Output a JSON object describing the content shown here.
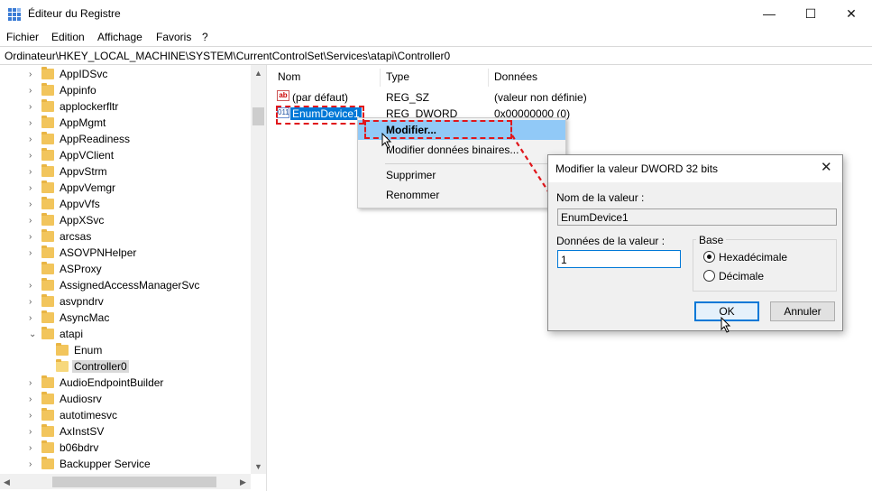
{
  "window": {
    "title": "Éditeur du Registre",
    "minimize": "—",
    "maximize": "☐",
    "close": "✕"
  },
  "menu": [
    "Fichier",
    "Edition",
    "Affichage",
    "Favoris",
    "?"
  ],
  "address": "Ordinateur\\HKEY_LOCAL_MACHINE\\SYSTEM\\CurrentControlSet\\Services\\atapi\\Controller0",
  "tree": {
    "items": [
      {
        "label": "AppIDSvc",
        "expander": "›",
        "indent": 0
      },
      {
        "label": "Appinfo",
        "expander": "›",
        "indent": 0
      },
      {
        "label": "applockerfltr",
        "expander": "›",
        "indent": 0
      },
      {
        "label": "AppMgmt",
        "expander": "›",
        "indent": 0
      },
      {
        "label": "AppReadiness",
        "expander": "›",
        "indent": 0
      },
      {
        "label": "AppVClient",
        "expander": "›",
        "indent": 0
      },
      {
        "label": "AppvStrm",
        "expander": "›",
        "indent": 0
      },
      {
        "label": "AppvVemgr",
        "expander": "›",
        "indent": 0
      },
      {
        "label": "AppvVfs",
        "expander": "›",
        "indent": 0
      },
      {
        "label": "AppXSvc",
        "expander": "›",
        "indent": 0
      },
      {
        "label": "arcsas",
        "expander": "›",
        "indent": 0
      },
      {
        "label": "ASOVPNHelper",
        "expander": "›",
        "indent": 0
      },
      {
        "label": "ASProxy",
        "expander": "",
        "indent": 0
      },
      {
        "label": "AssignedAccessManagerSvc",
        "expander": "›",
        "indent": 0
      },
      {
        "label": "asvpndrv",
        "expander": "›",
        "indent": 0
      },
      {
        "label": "AsyncMac",
        "expander": "›",
        "indent": 0
      },
      {
        "label": "atapi",
        "expander": "⌄",
        "indent": 0
      },
      {
        "label": "Enum",
        "expander": "",
        "indent": 1
      },
      {
        "label": "Controller0",
        "expander": "",
        "indent": 1,
        "selected": true
      },
      {
        "label": "AudioEndpointBuilder",
        "expander": "›",
        "indent": 0
      },
      {
        "label": "Audiosrv",
        "expander": "›",
        "indent": 0
      },
      {
        "label": "autotimesvc",
        "expander": "›",
        "indent": 0
      },
      {
        "label": "AxInstSV",
        "expander": "›",
        "indent": 0
      },
      {
        "label": "b06bdrv",
        "expander": "›",
        "indent": 0
      },
      {
        "label": "Backupper Service",
        "expander": "›",
        "indent": 0
      }
    ]
  },
  "list": {
    "columns": [
      "Nom",
      "Type",
      "Données"
    ],
    "rows": [
      {
        "icon": "ab",
        "name": "(par défaut)",
        "type": "REG_SZ",
        "data": "(valeur non définie)"
      },
      {
        "icon": "011",
        "name": "EnumDevice1",
        "type": "REG_DWORD",
        "data": "0x00000000 (0)"
      }
    ]
  },
  "context_menu": {
    "items": [
      "Modifier...",
      "Modifier données binaires...",
      "Supprimer",
      "Renommer"
    ]
  },
  "dialog": {
    "title": "Modifier la valeur DWORD 32 bits",
    "close": "✕",
    "name_label": "Nom de la valeur :",
    "name_value": "EnumDevice1",
    "data_label": "Données de la valeur :",
    "data_value": "1",
    "base_label": "Base",
    "base_options": [
      "Hexadécimale",
      "Décimale"
    ],
    "base_selected": "Hexadécimale",
    "ok": "OK",
    "cancel": "Annuler"
  },
  "colors": {
    "selection": "#0078d7",
    "menu_highlight": "#91c9f7",
    "annotation": "#e0161b",
    "folder": "#f2c55c"
  }
}
